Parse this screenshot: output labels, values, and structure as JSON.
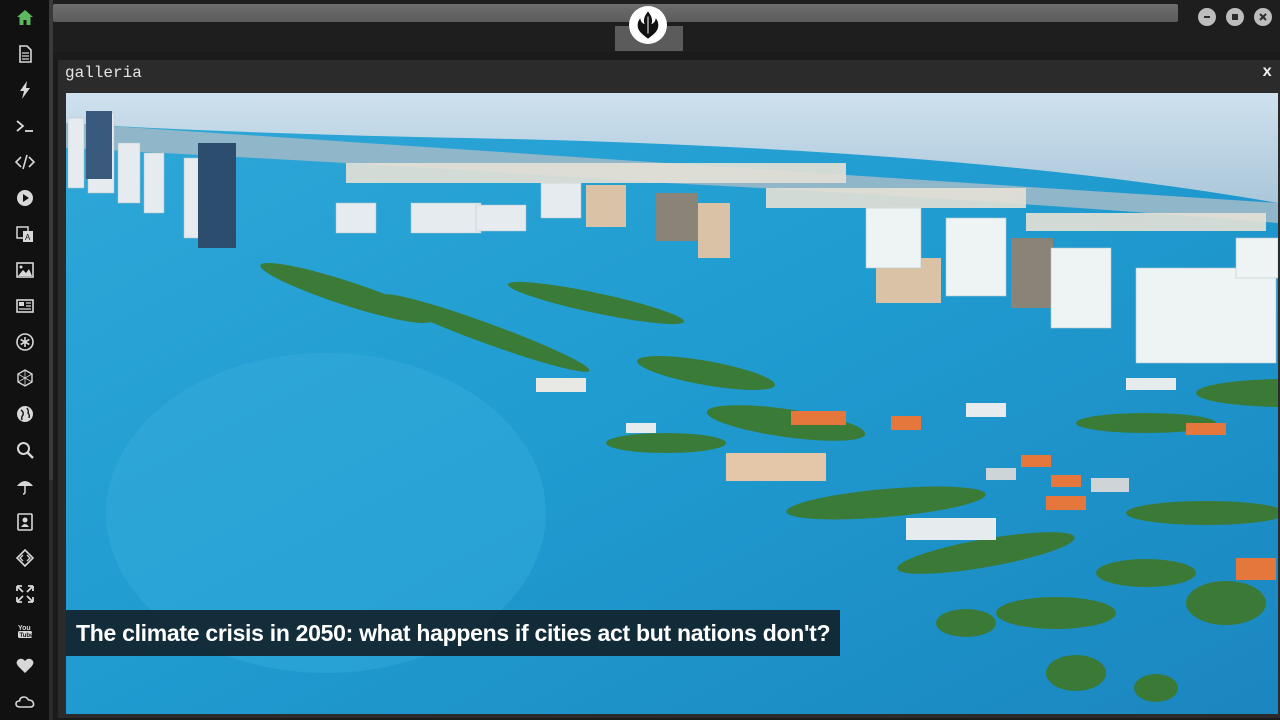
{
  "sidebar": {
    "items": [
      {
        "name": "home-icon",
        "active": true
      },
      {
        "name": "document-icon"
      },
      {
        "name": "lightning-icon"
      },
      {
        "name": "terminal-icon"
      },
      {
        "name": "code-icon"
      },
      {
        "name": "play-icon"
      },
      {
        "name": "translate-icon"
      },
      {
        "name": "image-icon"
      },
      {
        "name": "news-icon"
      },
      {
        "name": "asterisk-icon"
      },
      {
        "name": "hexagon-icon"
      },
      {
        "name": "globe-icon"
      },
      {
        "name": "search-icon"
      },
      {
        "name": "umbrella-icon"
      },
      {
        "name": "contacts-icon"
      },
      {
        "name": "diamond-code-icon"
      },
      {
        "name": "expand-icon"
      },
      {
        "name": "youtube-icon"
      },
      {
        "name": "heart-icon"
      },
      {
        "name": "cloud-icon"
      }
    ]
  },
  "window": {
    "logo": "rebel-alliance-logo",
    "buttons": [
      "minimize",
      "maximize",
      "close"
    ]
  },
  "panel": {
    "title": "galleria",
    "close_label": "x",
    "caption": "The climate crisis in 2050: what happens if cities act but nations don't?",
    "image": "flooded coastal city aerial photo"
  },
  "colors": {
    "active": "#5cb85c",
    "water": "#2aa6d6"
  }
}
